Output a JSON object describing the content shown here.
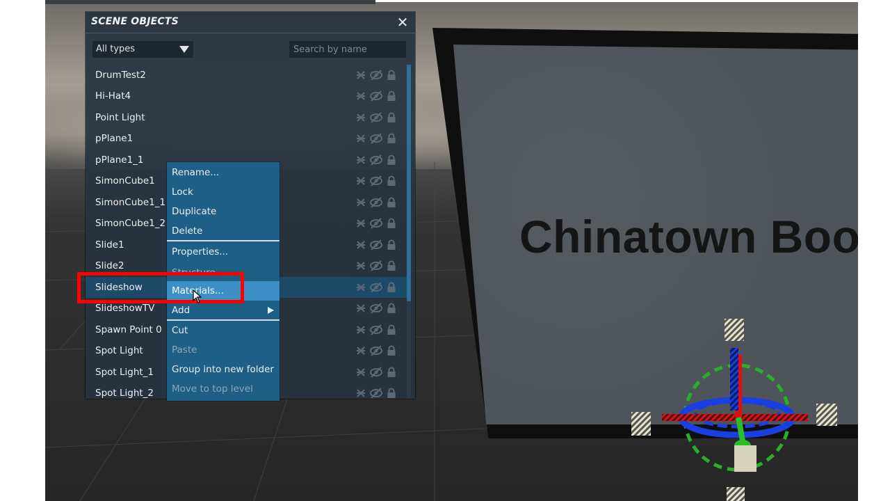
{
  "panel": {
    "title": "SCENE OBJECTS",
    "close_icon": "close-icon",
    "type_filter": {
      "selected": "All types"
    },
    "search": {
      "placeholder": "Search by name",
      "value": ""
    },
    "row_icons": [
      "snap-off-icon",
      "visibility-off-icon",
      "lock-icon"
    ],
    "items": [
      {
        "label": "DrumTest2"
      },
      {
        "label": "Hi-Hat4"
      },
      {
        "label": "Point Light"
      },
      {
        "label": "pPlane1"
      },
      {
        "label": "pPlane1_1"
      },
      {
        "label": "SimonCube1"
      },
      {
        "label": "SimonCube1_1"
      },
      {
        "label": "SimonCube1_2"
      },
      {
        "label": "Slide1"
      },
      {
        "label": "Slide2"
      },
      {
        "label": "Slideshow",
        "selected": true
      },
      {
        "label": "SlideshowTV"
      },
      {
        "label": "Spawn Point 0"
      },
      {
        "label": "Spot Light"
      },
      {
        "label": "Spot Light_1"
      },
      {
        "label": "Spot Light_2"
      }
    ]
  },
  "context_menu": {
    "items": [
      {
        "label": "Rename..."
      },
      {
        "label": "Lock"
      },
      {
        "label": "Duplicate"
      },
      {
        "label": "Delete"
      },
      {
        "label": "Properties..."
      },
      {
        "label": "Materials...",
        "highlighted": true
      },
      {
        "label": "Add",
        "submenu": true
      },
      {
        "label": "Cut"
      },
      {
        "label": "Paste",
        "disabled": true
      },
      {
        "label": "Group into new folder"
      },
      {
        "label": "Move to top level",
        "disabled": true
      }
    ]
  },
  "viewport": {
    "billboard_text": "Chinatown Boo"
  },
  "colors": {
    "panel_bg": "#26343f",
    "menu_bg": "#1e5f86",
    "menu_highlight": "#3d8fc6",
    "highlight_box": "#ff0000"
  }
}
